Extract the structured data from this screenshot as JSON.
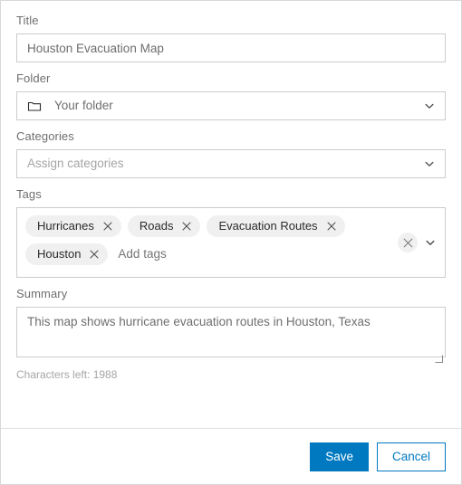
{
  "colors": {
    "accent": "#0079c1",
    "label_text": "#6e6e6e",
    "placeholder_text": "#a5a5a5",
    "chip_bg": "#f0f0f0",
    "border": "#cccccc"
  },
  "form": {
    "title": {
      "label": "Title",
      "value": "Houston Evacuation Map",
      "placeholder": "Title"
    },
    "folder": {
      "label": "Folder",
      "value": "Your folder",
      "icon": "folder-icon",
      "chevron": "chevron-down-icon"
    },
    "categories": {
      "label": "Categories",
      "placeholder": "Assign categories",
      "value": "",
      "chevron": "chevron-down-icon"
    },
    "tags": {
      "label": "Tags",
      "chips": [
        {
          "label": "Hurricanes",
          "remove_icon": "close-icon"
        },
        {
          "label": "Roads",
          "remove_icon": "close-icon"
        },
        {
          "label": "Evacuation Routes",
          "remove_icon": "close-icon"
        },
        {
          "label": "Houston",
          "remove_icon": "close-icon"
        }
      ],
      "input_placeholder": "Add tags",
      "clear_icon": "close-icon",
      "chevron": "chevron-down-icon"
    },
    "summary": {
      "label": "Summary",
      "value": "This map shows hurricane evacuation routes in Houston, Texas",
      "placeholder": "Summary",
      "characters_left": "Characters left: 1988"
    }
  },
  "footer": {
    "save_label": "Save",
    "cancel_label": "Cancel"
  }
}
